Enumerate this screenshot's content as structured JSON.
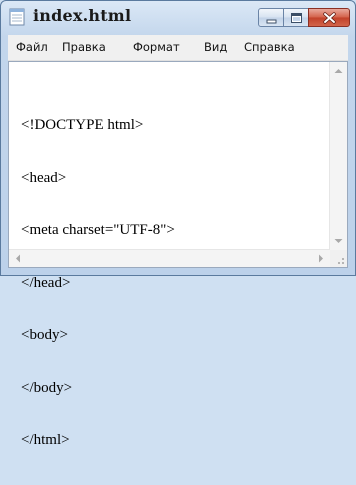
{
  "window": {
    "title": "index.html"
  },
  "menu": {
    "items": [
      {
        "label": "Файл"
      },
      {
        "label": "Правка"
      },
      {
        "label": "Формат"
      },
      {
        "label": "Вид"
      },
      {
        "label": "Справка"
      }
    ]
  },
  "editor": {
    "lines": [
      "<!DOCTYPE html>",
      "<head>",
      "<meta charset=\"UTF-8\">",
      "</head>",
      "<body>",
      "</body>",
      "</html>"
    ]
  },
  "icons": {
    "app": "notepad-icon",
    "minimize": "minimize-icon",
    "maximize": "maximize-icon",
    "close": "close-icon"
  },
  "colors": {
    "title_bar": "#c3d6ec",
    "close_button": "#c2412a",
    "editor_background": "#ffffff"
  }
}
